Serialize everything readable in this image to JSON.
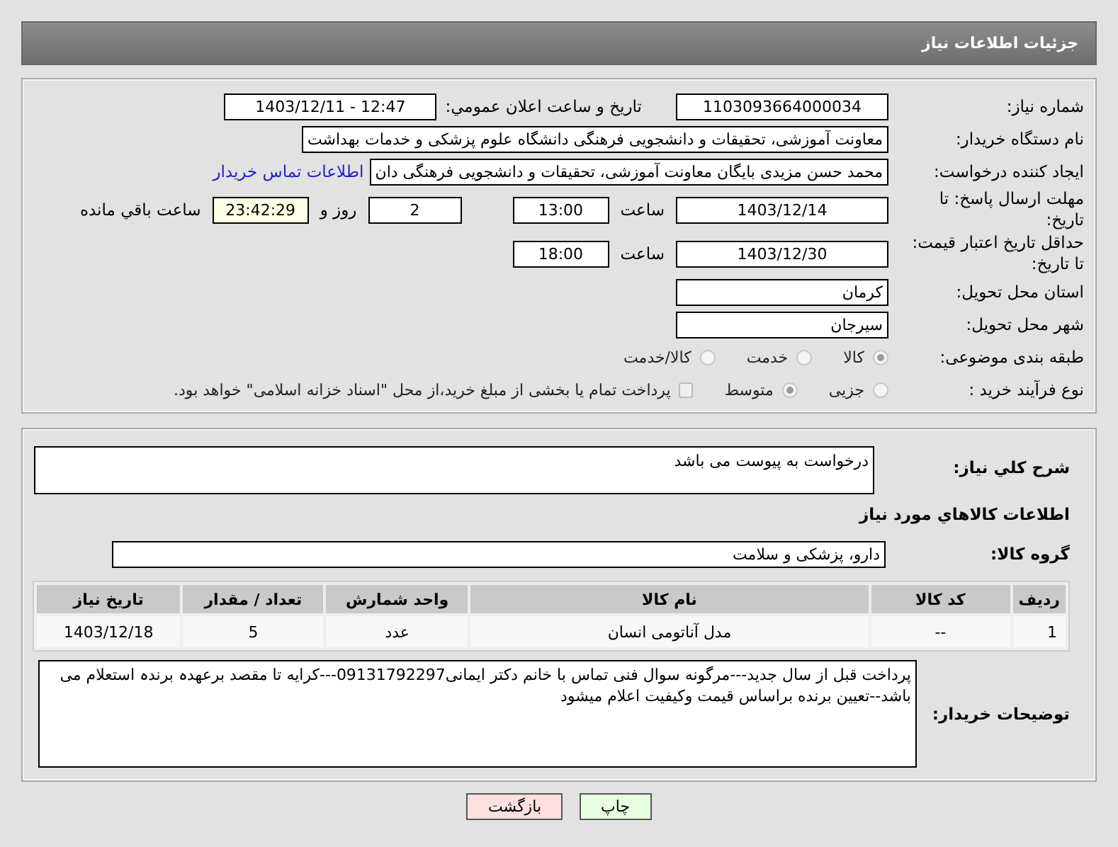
{
  "header": {
    "title": "جزئیات اطلاعات نیاز"
  },
  "details": {
    "need_number": {
      "label": "شماره نیاز:",
      "value": "1103093664000034"
    },
    "announce": {
      "label": "تاریخ و ساعت اعلان عمومي:",
      "value": "1403/12/11 - 12:47"
    },
    "buyer": {
      "label": "نام دستگاه خریدار:",
      "value": "معاونت آموزشی، تحقیقات و دانشجویی فرهنگی دانشگاه علوم پزشکی و خدمات بهداشت"
    },
    "creator": {
      "label": "ایجاد کننده درخواست:",
      "value": "محمد حسن  مزیدی بایگان معاونت آموزشی، تحقیقات و دانشجویی فرهنگی دان",
      "link": "اطلاعات تماس خریدار"
    },
    "deadline": {
      "label": "مهلت ارسال پاسخ: تا تاریخ:",
      "date": "1403/12/14",
      "time_label": "ساعت",
      "time": "13:00",
      "days": "2",
      "days_label": "روز و",
      "remaining": "23:42:29",
      "remaining_label": "ساعت باقي مانده"
    },
    "validity": {
      "label": "حداقل تاریخ اعتبار قیمت: تا تاریخ:",
      "date": "1403/12/30",
      "time_label": "ساعت",
      "time": "18:00"
    },
    "province": {
      "label": "استان محل تحویل:",
      "value": "کرمان"
    },
    "city": {
      "label": "شهر محل تحویل:",
      "value": "سیرجان"
    },
    "category": {
      "label": "طبقه بندی موضوعی:",
      "options": [
        {
          "label": "کالا",
          "selected": true
        },
        {
          "label": "خدمت",
          "selected": false
        },
        {
          "label": "کالا/خدمت",
          "selected": false
        }
      ]
    },
    "process": {
      "label": "نوع فرآیند خرید :",
      "options": [
        {
          "label": "جزیی",
          "selected": false
        },
        {
          "label": "متوسط",
          "selected": true
        }
      ],
      "treasury": {
        "checked": false,
        "label": "پرداخت تمام یا بخشی از مبلغ خرید،از محل \"اسناد خزانه اسلامی\" خواهد بود."
      }
    }
  },
  "needs": {
    "description": {
      "label": "شرح کلي نياز:",
      "value": "درخواست به پیوست می باشد"
    },
    "section_title": "اطلاعات کالاهاي مورد نياز",
    "group": {
      "label": "گروه کالا:",
      "value": "دارو، پزشکی و سلامت"
    },
    "table": {
      "columns": [
        "ردیف",
        "کد کالا",
        "نام کالا",
        "واحد شمارش",
        "تعداد / مقدار",
        "تاریخ نیاز"
      ],
      "rows": [
        [
          "1",
          "--",
          "مدل آناتومی انسان",
          "عدد",
          "5",
          "1403/12/18"
        ]
      ]
    },
    "buyer_notes": {
      "label": "توضیحات خریدار:",
      "value": "پرداخت قبل از سال جدید---مرگونه سوال فنی تماس با خانم دکتر ایمانی09131792297---کرایه تا مقصد برعهدہ برندہ استعلام می باشد--تعیین برنده براساس قیمت وکیفیت اعلام میشود"
    }
  },
  "buttons": [
    {
      "label": "چاپ",
      "kind": "print"
    },
    {
      "label": "بازگشت",
      "kind": "back"
    }
  ]
}
